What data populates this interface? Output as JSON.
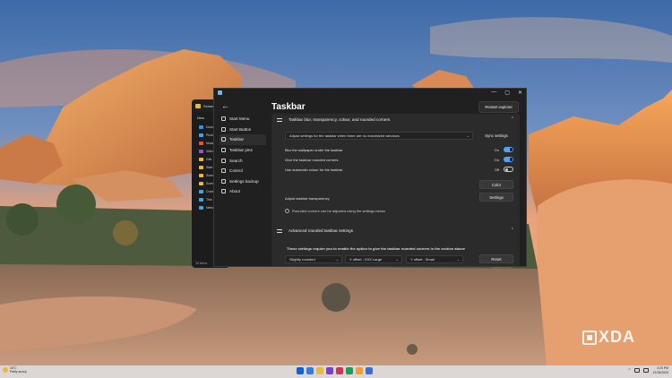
{
  "window": {
    "title": "Taskbar",
    "controls": [
      "—",
      "▢",
      "✕"
    ],
    "restart_label": "Restart explorer"
  },
  "explorer": {
    "tab_label": "Screens",
    "new_label": "New",
    "items": [
      {
        "label": "Docu",
        "color": "#3a8ee6"
      },
      {
        "label": "Pictu",
        "color": "#4aa3df"
      },
      {
        "label": "Music",
        "color": "#e0533d"
      },
      {
        "label": "Video",
        "color": "#8a5cd1"
      },
      {
        "label": "Gifs",
        "color": "#e8b93a"
      },
      {
        "label": "Start",
        "color": "#e8b93a"
      },
      {
        "label": "Scree",
        "color": "#e8b93a"
      },
      {
        "label": "Scree",
        "color": "#e8b93a"
      },
      {
        "label": "Creat",
        "color": "#4aa3df"
      },
      {
        "label": "This",
        "color": "#4aa3df"
      },
      {
        "label": "Netw",
        "color": "#4aa3df"
      }
    ],
    "footer": "33 items"
  },
  "nav": {
    "items": [
      {
        "label": "Start Menu",
        "icon": "start-menu-icon"
      },
      {
        "label": "Start Button",
        "icon": "start-button-icon"
      },
      {
        "label": "Taskbar",
        "icon": "taskbar-icon",
        "active": true
      },
      {
        "label": "Taskbar pins",
        "icon": "pin-icon"
      },
      {
        "label": "Search",
        "icon": "search-icon"
      },
      {
        "label": "Control",
        "icon": "control-icon"
      },
      {
        "label": "Settings backup",
        "icon": "backup-icon"
      },
      {
        "label": "About",
        "icon": "info-icon"
      }
    ]
  },
  "section1": {
    "title": "Taskbar blur, transparency, colour, and rounded corners",
    "dropdown": "Adjust settings for the taskbar when there are no maximized windows",
    "sync_label": "Sync settings",
    "rows": [
      {
        "label": "Blur the wallpaper under the taskbar",
        "state": "On",
        "on": true
      },
      {
        "label": "Give the taskbar rounded corners",
        "state": "On",
        "on": true
      },
      {
        "label": "Use automatic colour for the taskbar",
        "state": "Off",
        "on": false
      }
    ],
    "color_label": "Color",
    "transparency_label": "Adjust taskbar transparency",
    "settings_label": "Settings",
    "info": "Rounded corners can be adjusted using the settings below"
  },
  "section2": {
    "title": "Advanced rounded taskbar settings",
    "description": "These settings require you to enable the option to give the taskbar rounded corners in the section above",
    "dropdowns": [
      "Slightly rounded",
      "X offset : XXX Large",
      "Y offset : Small"
    ],
    "reset_label": "Reset"
  },
  "watermark": "XDA",
  "taskbar": {
    "weather_temp": "16°C",
    "weather_desc": "Partly sunny",
    "time": "4:23 PM",
    "date": "12/15/2024",
    "pinned_colors": [
      "#0b63d6",
      "#2f7de0",
      "#e8b93a",
      "#7b3fd0",
      "#d1345b",
      "#1a9e5c",
      "#f0a030",
      "#3a6fd8"
    ]
  },
  "colors": {
    "accent": "#4fa3f7",
    "window_bg": "#202020",
    "card_bg": "#2b2b2b"
  }
}
